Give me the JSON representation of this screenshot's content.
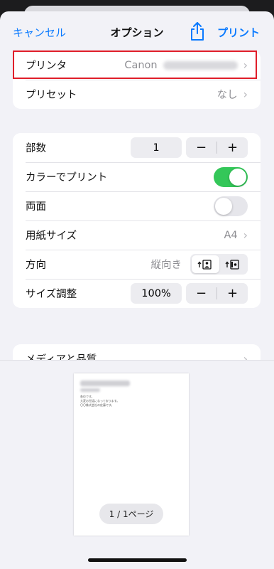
{
  "navbar": {
    "cancel_label": "キャンセル",
    "title": "オプション",
    "print_label": "プリント"
  },
  "printer_group": {
    "printer": {
      "label": "プリンタ",
      "value": "Canon"
    },
    "preset": {
      "label": "プリセット",
      "value": "なし"
    }
  },
  "options_group": {
    "copies": {
      "label": "部数",
      "value": "1",
      "minus": "−",
      "plus": "+"
    },
    "color": {
      "label": "カラーでプリント",
      "on": true
    },
    "duplex": {
      "label": "両面",
      "on": false
    },
    "paper_size": {
      "label": "用紙サイズ",
      "value": "A4"
    },
    "orientation": {
      "label": "方向",
      "value": "縦向き"
    },
    "scale": {
      "label": "サイズ調整",
      "value": "100%",
      "minus": "−",
      "plus": "+"
    }
  },
  "media_group": {
    "label": "メディアと品質"
  },
  "preview": {
    "page_lines": [
      "各位です。",
      "大変お世話になっております。",
      "〇〇株式会社の佐藤です。"
    ],
    "page_indicator": "1 / 1ページ"
  },
  "colors": {
    "accent": "#0a7aff",
    "toggle_on": "#34c759",
    "highlight": "#e01e2a"
  }
}
